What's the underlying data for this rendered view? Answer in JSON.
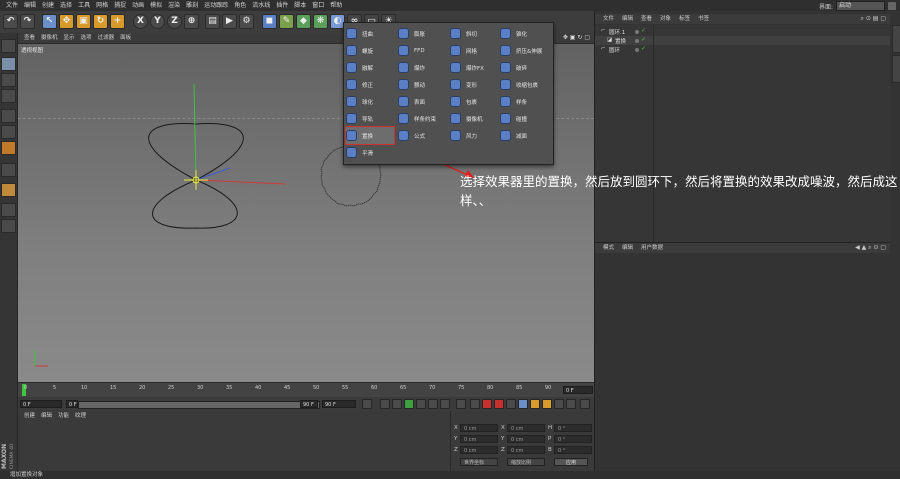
{
  "menubar": {
    "items": [
      "文件",
      "编辑",
      "创建",
      "选择",
      "工具",
      "网格",
      "捕捉",
      "动画",
      "模拟",
      "渲染",
      "雕刻",
      "运动跟踪",
      "角色",
      "流水线",
      "插件",
      "脚本",
      "窗口",
      "帮助"
    ],
    "layout_label": "界面:",
    "layout_value": "启动"
  },
  "toolbar": {
    "axis_x": "X",
    "axis_y": "Y",
    "axis_z": "Z"
  },
  "viewport": {
    "menu": [
      "查看",
      "摄像机",
      "显示",
      "选项",
      "过滤器",
      "面板"
    ],
    "label": "透视视图"
  },
  "deformer_popup": {
    "items": [
      [
        "扭曲",
        "膨胀",
        "斜切",
        "锥化"
      ],
      [
        "螺旋",
        "FFD",
        "网格",
        "挤压&伸展"
      ],
      [
        "融解",
        "爆炸",
        "爆炸FX",
        "破碎"
      ],
      [
        "修正",
        "颤动",
        "变形",
        "收缩包裹"
      ],
      [
        "球化",
        "表面",
        "包裹",
        "样条"
      ],
      [
        "导轨",
        "样条约束",
        "摄像机",
        "碰撞"
      ],
      [
        "置换",
        "公式",
        "风力",
        "减面"
      ],
      [
        "平滑",
        "",
        "",
        ""
      ]
    ],
    "selected": "置换"
  },
  "annotation": {
    "text": "选择效果器里的置换，然后放到圆环下，然后将置换的效果改成噪波，然后成这样、、"
  },
  "timeline": {
    "ticks": [
      "0",
      "5",
      "10",
      "15",
      "20",
      "25",
      "30",
      "35",
      "40",
      "45",
      "50",
      "55",
      "60",
      "65",
      "70",
      "75",
      "80",
      "85",
      "90"
    ],
    "end_frame": "0 F"
  },
  "playbar": {
    "start": "0 F",
    "range_start": "0 F",
    "range_end": "90 F",
    "end": "90 F"
  },
  "material_menu": [
    "创建",
    "编辑",
    "功能",
    "纹理"
  ],
  "coords": {
    "rows": [
      {
        "a": "X",
        "v1": "0 cm",
        "b": "X",
        "v2": "0 cm",
        "c": "H",
        "v3": "0 °"
      },
      {
        "a": "Y",
        "v1": "0 cm",
        "b": "Y",
        "v2": "0 cm",
        "c": "P",
        "v3": "0 °"
      },
      {
        "a": "Z",
        "v1": "0 cm",
        "b": "Z",
        "v2": "0 cm",
        "c": "B",
        "v3": "0 °"
      }
    ],
    "world": "世界坐标",
    "scale": "缩放比例",
    "apply": "应用"
  },
  "object_manager": {
    "menu": [
      "文件",
      "编辑",
      "查看",
      "对象",
      "标签",
      "书签"
    ],
    "items": [
      "圆环.1",
      "置换",
      "圆环"
    ]
  },
  "attribute_manager": {
    "menu": [
      "模式",
      "编辑",
      "用户数据"
    ]
  },
  "status": {
    "text": "增加置换对象"
  },
  "brand": {
    "line1": "MAXON",
    "line2": "CINEMA 4D"
  }
}
